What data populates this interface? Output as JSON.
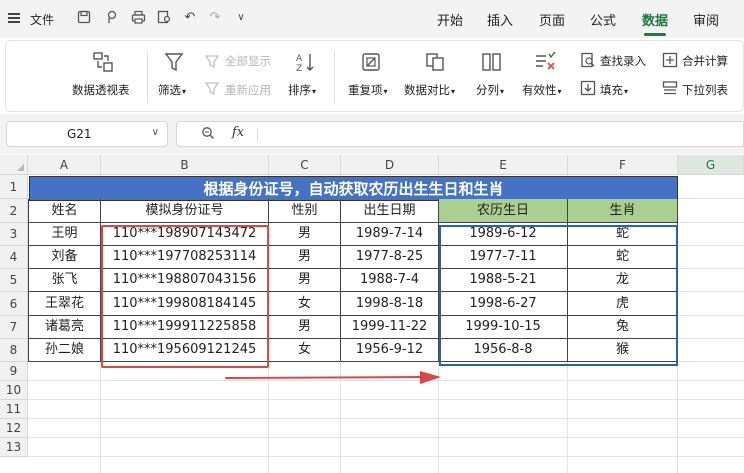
{
  "menubar": {
    "file_label": "文件",
    "tabs": [
      "开始",
      "插入",
      "页面",
      "公式",
      "数据",
      "审阅"
    ],
    "active_tab": "数据"
  },
  "ribbon": {
    "pivot": "数据透视表",
    "filter": "筛选",
    "show_all": "全部显示",
    "reapply": "重新应用",
    "sort": "排序",
    "duplicates": "重复项",
    "compare": "数据对比",
    "split": "分列",
    "validity": "有效性",
    "lookup": "查找录入",
    "fill": "填充",
    "merge_calc": "合并计算",
    "dropdown_list": "下拉列表"
  },
  "formula_bar": {
    "name_box": "G21",
    "fx_label": "fx",
    "formula": ""
  },
  "sheet": {
    "columns": [
      "A",
      "B",
      "C",
      "D",
      "E",
      "F",
      "G"
    ],
    "rows": [
      "1",
      "2",
      "3",
      "4",
      "5",
      "6",
      "7",
      "8",
      "9",
      "10",
      "11",
      "12",
      "13"
    ],
    "title": "根据身份证号，自动获取农历出生生日和生肖",
    "headers": [
      "姓名",
      "模拟身份证号",
      "性别",
      "出生日期",
      "农历生日",
      "生肖"
    ],
    "data": [
      [
        "王明",
        "110***198907143472",
        "男",
        "1989-7-14",
        "1989-6-12",
        "蛇"
      ],
      [
        "刘备",
        "110***197708253114",
        "男",
        "1977-8-25",
        "1977-7-11",
        "蛇"
      ],
      [
        "张飞",
        "110***198807043156",
        "男",
        "1988-7-4",
        "1988-5-21",
        "龙"
      ],
      [
        "王翠花",
        "110***199808184145",
        "女",
        "1998-8-18",
        "1998-6-27",
        "虎"
      ],
      [
        "诸葛亮",
        "110***199911225858",
        "男",
        "1999-11-22",
        "1999-10-15",
        "兔"
      ],
      [
        "孙二娘",
        "110***195609121245",
        "女",
        "1956-9-12",
        "1956-8-8",
        "猴"
      ]
    ]
  },
  "colors": {
    "accent": "#1f7a3c",
    "title_fill": "#4472c4",
    "header_green": "#a9d08e",
    "red_box": "#e04646",
    "blue_box": "#2f5eb5"
  }
}
